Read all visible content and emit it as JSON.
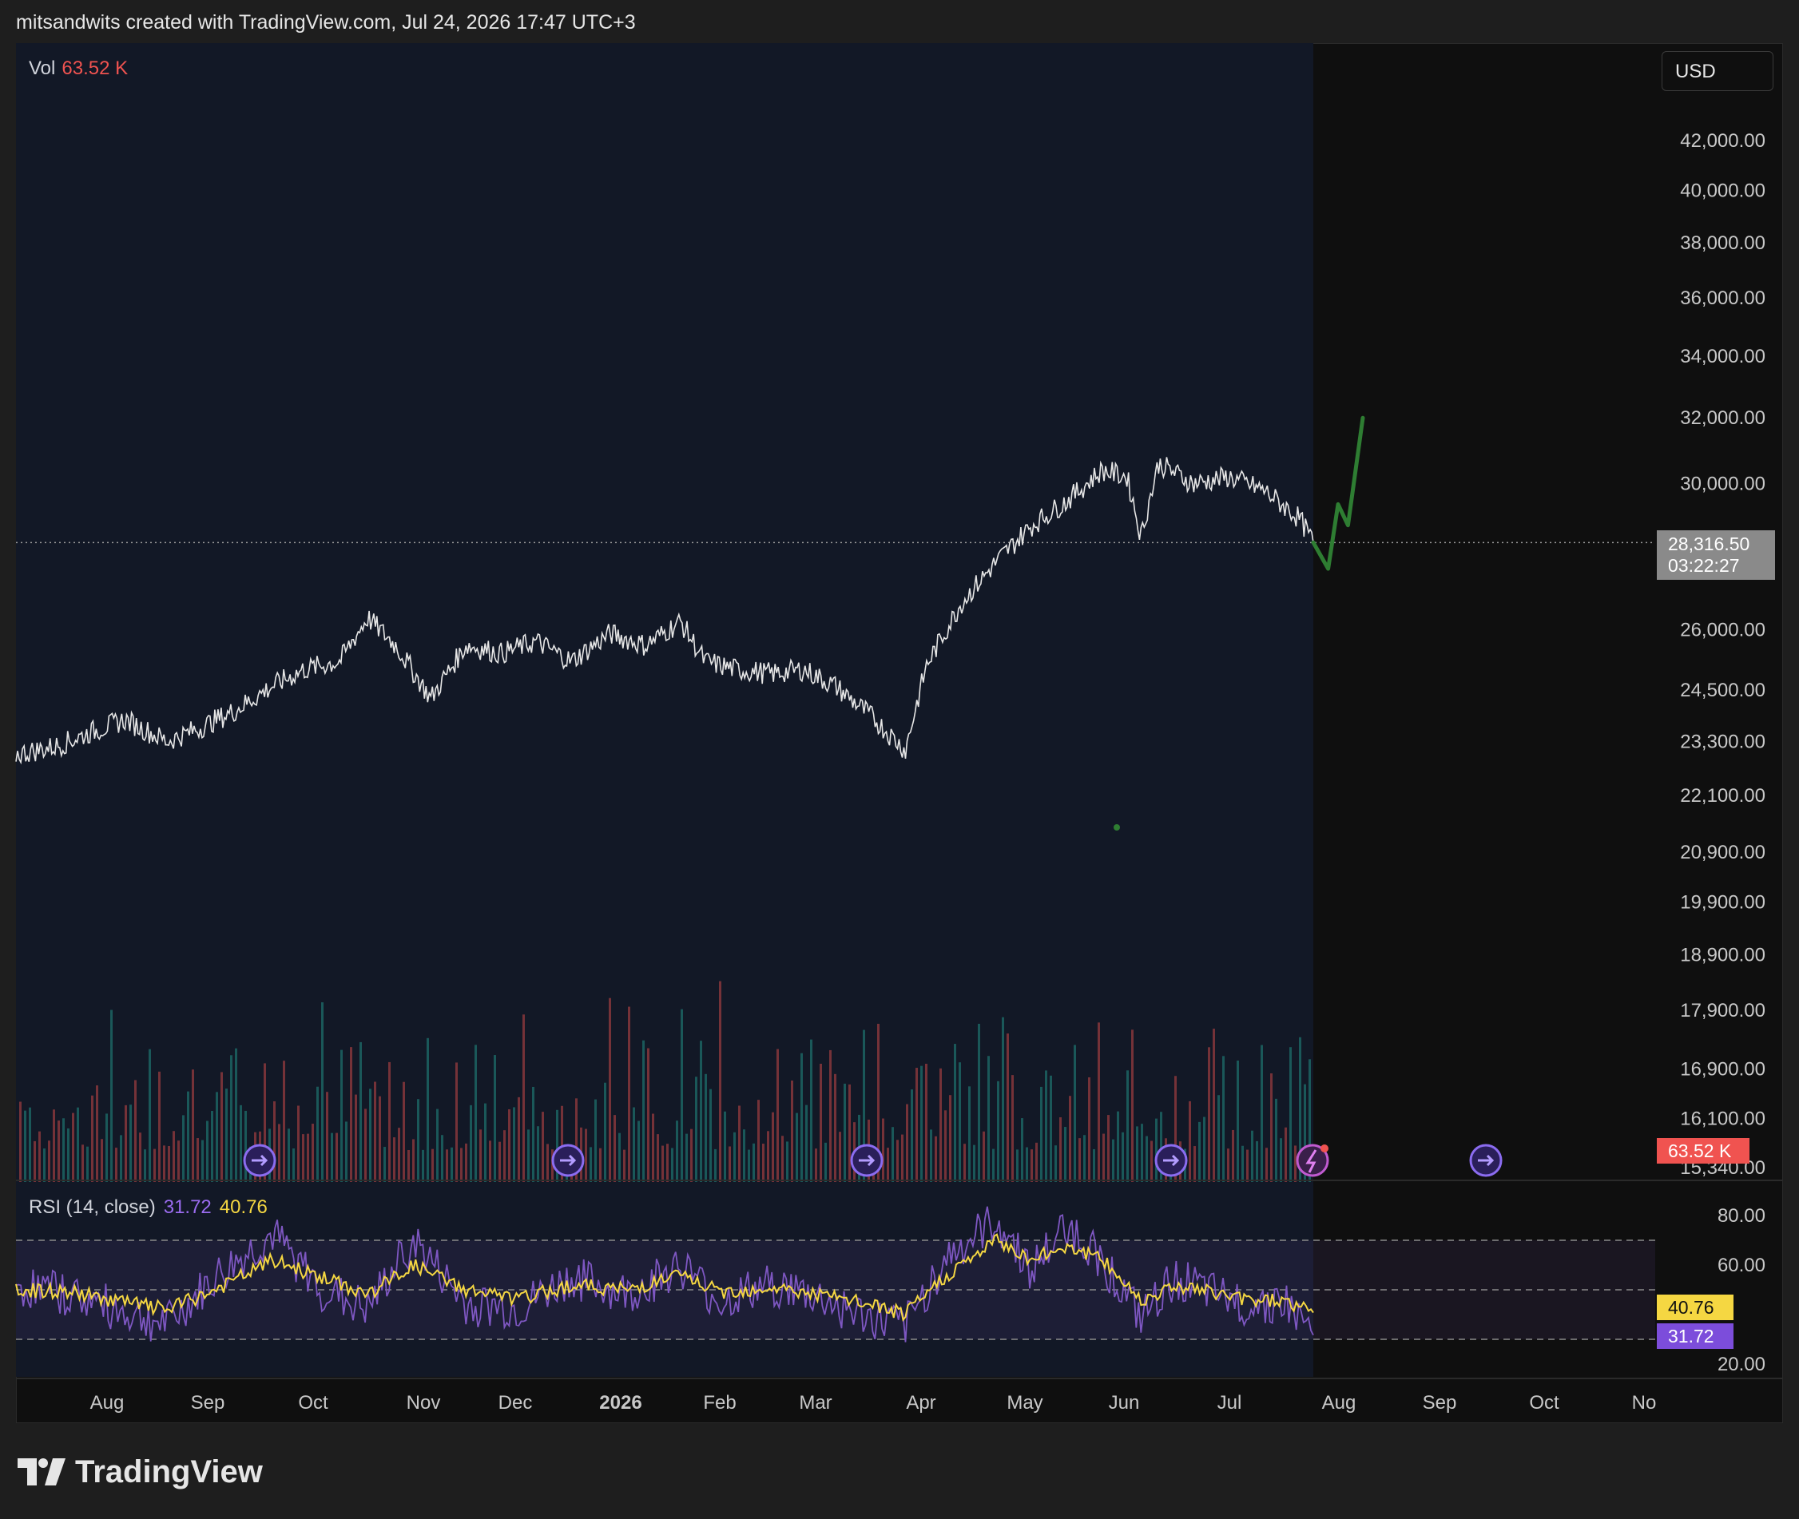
{
  "header": {
    "text": "mitsandwits created with TradingView.com, Jul 24, 2026 17:47 UTC+3"
  },
  "currency": "USD",
  "legend": {
    "vol_label": "Vol",
    "vol_value": "63.52 K",
    "rsi_label": "RSI (14, close)",
    "rsi_value": "31.72",
    "rsi_ma_value": "40.76"
  },
  "tags": {
    "last_price": "28,316.50",
    "countdown": "03:22:27",
    "volume": "63.52 K",
    "rsi_ma": "40.76",
    "rsi": "31.72"
  },
  "logo": {
    "text": "TradingView"
  },
  "colors": {
    "price_line": "#e6e6e6",
    "projection": "#2e7d32",
    "rsi": "#7e57c2",
    "rsi_ma": "#f5d742",
    "vol_up": "#26a69a",
    "vol_down": "#ef5350",
    "session_bg": "#121826"
  },
  "chart_data": {
    "type": "line",
    "price_axis": {
      "scale": "log",
      "ticks": [
        15340,
        16100,
        16900,
        17900,
        18900,
        19900,
        20900,
        22100,
        23300,
        24500,
        26000,
        28316.5,
        30000,
        32000,
        34000,
        36000,
        38000,
        40000,
        42000
      ],
      "tick_labels": [
        "15,340.00",
        "16,100.00",
        "16,900.00",
        "17,900.00",
        "18,900.00",
        "19,900.00",
        "20,900.00",
        "22,100.00",
        "23,300.00",
        "24,500.00",
        "26,000.00",
        "28,316.50",
        "30,000.00",
        "32,000.00",
        "34,000.00",
        "36,000.00",
        "38,000.00",
        "40,000.00",
        "42,000.00"
      ]
    },
    "time_axis": {
      "labels": [
        "Aug",
        "Sep",
        "Oct",
        "Nov",
        "Dec",
        "2026",
        "Feb",
        "Mar",
        "Apr",
        "May",
        "Jun",
        "Jul",
        "Aug",
        "Sep",
        "Oct",
        "No"
      ]
    },
    "price_series": {
      "name": "",
      "x": [
        "2025-07-20",
        "2025-08-01",
        "2025-08-10",
        "2025-08-20",
        "2025-09-01",
        "2025-09-10",
        "2025-09-20",
        "2025-10-01",
        "2025-10-10",
        "2025-10-20",
        "2025-10-28",
        "2025-11-05",
        "2025-11-15",
        "2025-11-25",
        "2025-12-05",
        "2025-12-15",
        "2025-12-25",
        "2026-01-05",
        "2026-01-15",
        "2026-01-25",
        "2026-02-01",
        "2026-02-10",
        "2026-02-20",
        "2026-03-01",
        "2026-03-10",
        "2026-03-20",
        "2026-03-30",
        "2026-04-05",
        "2026-04-15",
        "2026-04-25",
        "2026-05-05",
        "2026-05-15",
        "2026-05-25",
        "2026-06-01",
        "2026-06-05",
        "2026-06-10",
        "2026-06-20",
        "2026-06-30",
        "2026-07-10",
        "2026-07-20",
        "2026-07-24"
      ],
      "values": [
        23000,
        23200,
        23500,
        23800,
        23300,
        23600,
        24000,
        24600,
        25000,
        25200,
        26300,
        25600,
        24300,
        25600,
        25400,
        25700,
        25200,
        25900,
        25600,
        26200,
        25200,
        25000,
        24900,
        25000,
        24600,
        23900,
        23100,
        25100,
        26700,
        27800,
        28800,
        29500,
        30400,
        30200,
        28500,
        30600,
        30000,
        30200,
        29800,
        29000,
        28316.5
      ]
    },
    "projection": {
      "x": [
        "2026-07-24",
        "2026-07-27",
        "2026-07-29",
        "2026-07-31",
        "2026-08-03"
      ],
      "values": [
        28316.5,
        27600,
        29400,
        28800,
        32000
      ]
    },
    "volume": {
      "last": 63520
    },
    "rsi": {
      "axis_ticks": [
        20,
        60,
        80
      ],
      "bands": [
        30,
        50,
        70
      ],
      "x": [
        "2025-07-20",
        "2025-08-05",
        "2025-08-20",
        "2025-09-01",
        "2025-09-15",
        "2025-10-01",
        "2025-10-15",
        "2025-10-28",
        "2025-11-10",
        "2025-11-25",
        "2025-12-10",
        "2025-12-25",
        "2026-01-10",
        "2026-01-25",
        "2026-02-05",
        "2026-02-20",
        "2026-03-05",
        "2026-03-20",
        "2026-03-30",
        "2026-04-10",
        "2026-04-25",
        "2026-05-05",
        "2026-05-15",
        "2026-05-25",
        "2026-06-05",
        "2026-06-15",
        "2026-06-25",
        "2026-07-05",
        "2026-07-15",
        "2026-07-24"
      ],
      "values": [
        52,
        48,
        41,
        36,
        55,
        72,
        50,
        42,
        70,
        44,
        42,
        55,
        48,
        60,
        45,
        52,
        47,
        38,
        35,
        62,
        78,
        58,
        76,
        62,
        38,
        55,
        48,
        44,
        46,
        31.72
      ],
      "ma_values": [
        50,
        49,
        45,
        42,
        50,
        62,
        55,
        48,
        60,
        50,
        46,
        52,
        50,
        56,
        49,
        51,
        48,
        44,
        40,
        55,
        70,
        62,
        68,
        62,
        46,
        52,
        49,
        46,
        46,
        40.76
      ]
    }
  }
}
